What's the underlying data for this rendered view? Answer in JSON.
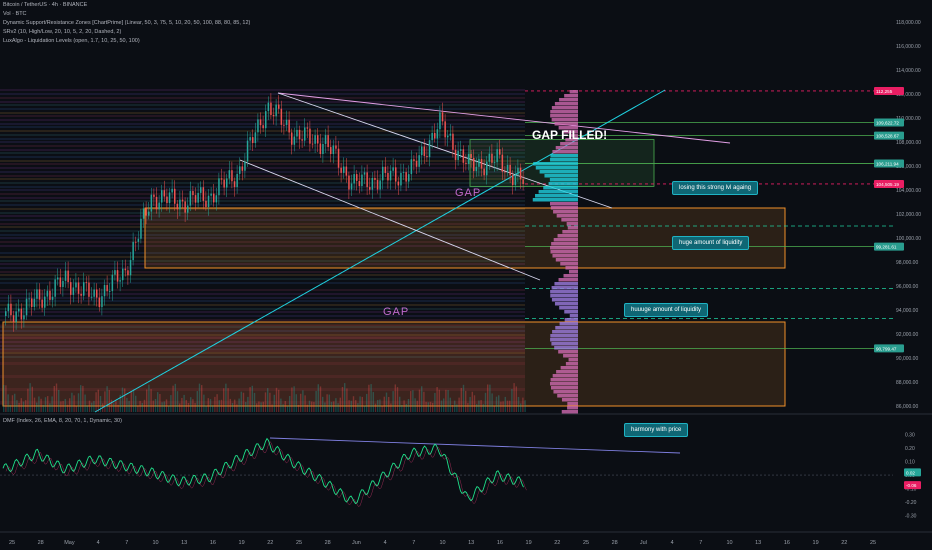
{
  "header": {
    "line1": "Bitcoin / TetherUS · 4h · BINANCE",
    "line2": "Vol · BTC",
    "line3": "Dynamic Support/Resistance Zones [ChartPrime] (Linear, 50, 3, 75, 5, 10, 20, 50, 100, 88, 80, 85, 12)",
    "line4": "SRv2 (10, High/Low, 20, 10, 5, 2, 20, Dashed, 2)",
    "line5": "LuxAlgo - Liquidation Levels (open, 1.7, 10, 25, 50, 100)"
  },
  "annotations": {
    "gap_filled": "GAP FILLED!",
    "gap_upper": "GAP",
    "gap_lower": "GAP",
    "callout_1": "losing this strong lvl againg",
    "callout_2": "huge amount of liquidity",
    "callout_3": "huuuge amount of liquidity",
    "callout_4": "harmony with price"
  },
  "colors": {
    "background": "#0b0e14",
    "up_candle": "#26a69a",
    "down_candle": "#ef5350",
    "accent_cyan": "#1fd1e0",
    "gap_zone": "#c06acb",
    "orange_box": "#f0902a",
    "green_level": "#4caf50"
  },
  "price_tags": [
    {
      "label": "112,255",
      "color": "#e91e63"
    },
    {
      "label": "109,622.72",
      "color": "#2a9d8f"
    },
    {
      "label": "108,528.67",
      "color": "#2a9d8f"
    },
    {
      "label": "106,211.94",
      "color": "#2a9d8f"
    },
    {
      "label": "104,505.19",
      "color": "#e91e63"
    },
    {
      "label": "99,281.61",
      "color": "#2a9d8f"
    },
    {
      "label": "90,799.47",
      "color": "#2a9d8f"
    }
  ],
  "chart_data": [
    {
      "type": "line",
      "title": "Bitcoin / TetherUS · 4h · BINANCE",
      "xlabel": "",
      "ylabel": "",
      "x_ticks": [
        "25",
        "28",
        "May",
        "4",
        "7",
        "10",
        "13",
        "16",
        "19",
        "22",
        "25",
        "28",
        "Jun",
        "4",
        "7",
        "10",
        "13",
        "16",
        "19",
        "22",
        "25",
        "28",
        "Jul",
        "4",
        "7",
        "10",
        "13",
        "16",
        "19",
        "22",
        "25"
      ],
      "y_ticks": [
        86000,
        88000,
        90000,
        92000,
        94000,
        96000,
        98000,
        100000,
        102000,
        104000,
        106000,
        108000,
        110000,
        112000,
        114000,
        116000,
        118000
      ],
      "ylim": [
        85500,
        119000
      ],
      "series": [
        {
          "name": "BTCUSDT",
          "x": [
            "Apr 25",
            "Apr 28",
            "May 1",
            "May 4",
            "May 7",
            "May 10",
            "May 13",
            "May 16",
            "May 19",
            "May 22",
            "May 25",
            "May 28",
            "Jun 1",
            "Jun 4",
            "Jun 7",
            "Jun 10",
            "Jun 13",
            "Jun 16",
            "Jun 17"
          ],
          "values": [
            93500,
            94800,
            96500,
            95000,
            97000,
            103500,
            103000,
            103500,
            105500,
            111000,
            108500,
            108000,
            104500,
            105000,
            105500,
            109500,
            106000,
            106500,
            104500
          ]
        }
      ],
      "levels": [
        112255,
        109622.72,
        108528.67,
        106211.94,
        104505.19,
        99281.61,
        90799.47
      ],
      "zones": [
        {
          "name": "GAP",
          "from": 97500,
          "to": 102500
        },
        {
          "name": "GAP",
          "from": 86000,
          "to": 93000
        }
      ]
    },
    {
      "type": "line",
      "title": "DMF (Index, 26, EMA, 8, 20, 70, 1, Dynamic, 30)",
      "ylim": [
        -0.32,
        0.35
      ],
      "y_ticks": [
        -0.3,
        -0.2,
        -0.1,
        0.0,
        0.1,
        0.2,
        0.3
      ],
      "series": [
        {
          "name": "DMF",
          "x": [
            "Apr 25",
            "Apr 28",
            "May 1",
            "May 4",
            "May 7",
            "May 10",
            "May 13",
            "May 16",
            "May 19",
            "May 22",
            "May 25",
            "May 28",
            "Jun 1",
            "Jun 4",
            "Jun 7",
            "Jun 10",
            "Jun 13",
            "Jun 16",
            "Jun 17"
          ],
          "values": [
            0.05,
            0.16,
            0.04,
            0.12,
            0.07,
            0.02,
            -0.05,
            -0.02,
            0.12,
            0.24,
            0.08,
            -0.05,
            -0.2,
            -0.02,
            0.16,
            0.2,
            -0.18,
            0.0,
            -0.06
          ]
        }
      ],
      "current": [
        "0.02",
        "-0.06"
      ]
    }
  ]
}
